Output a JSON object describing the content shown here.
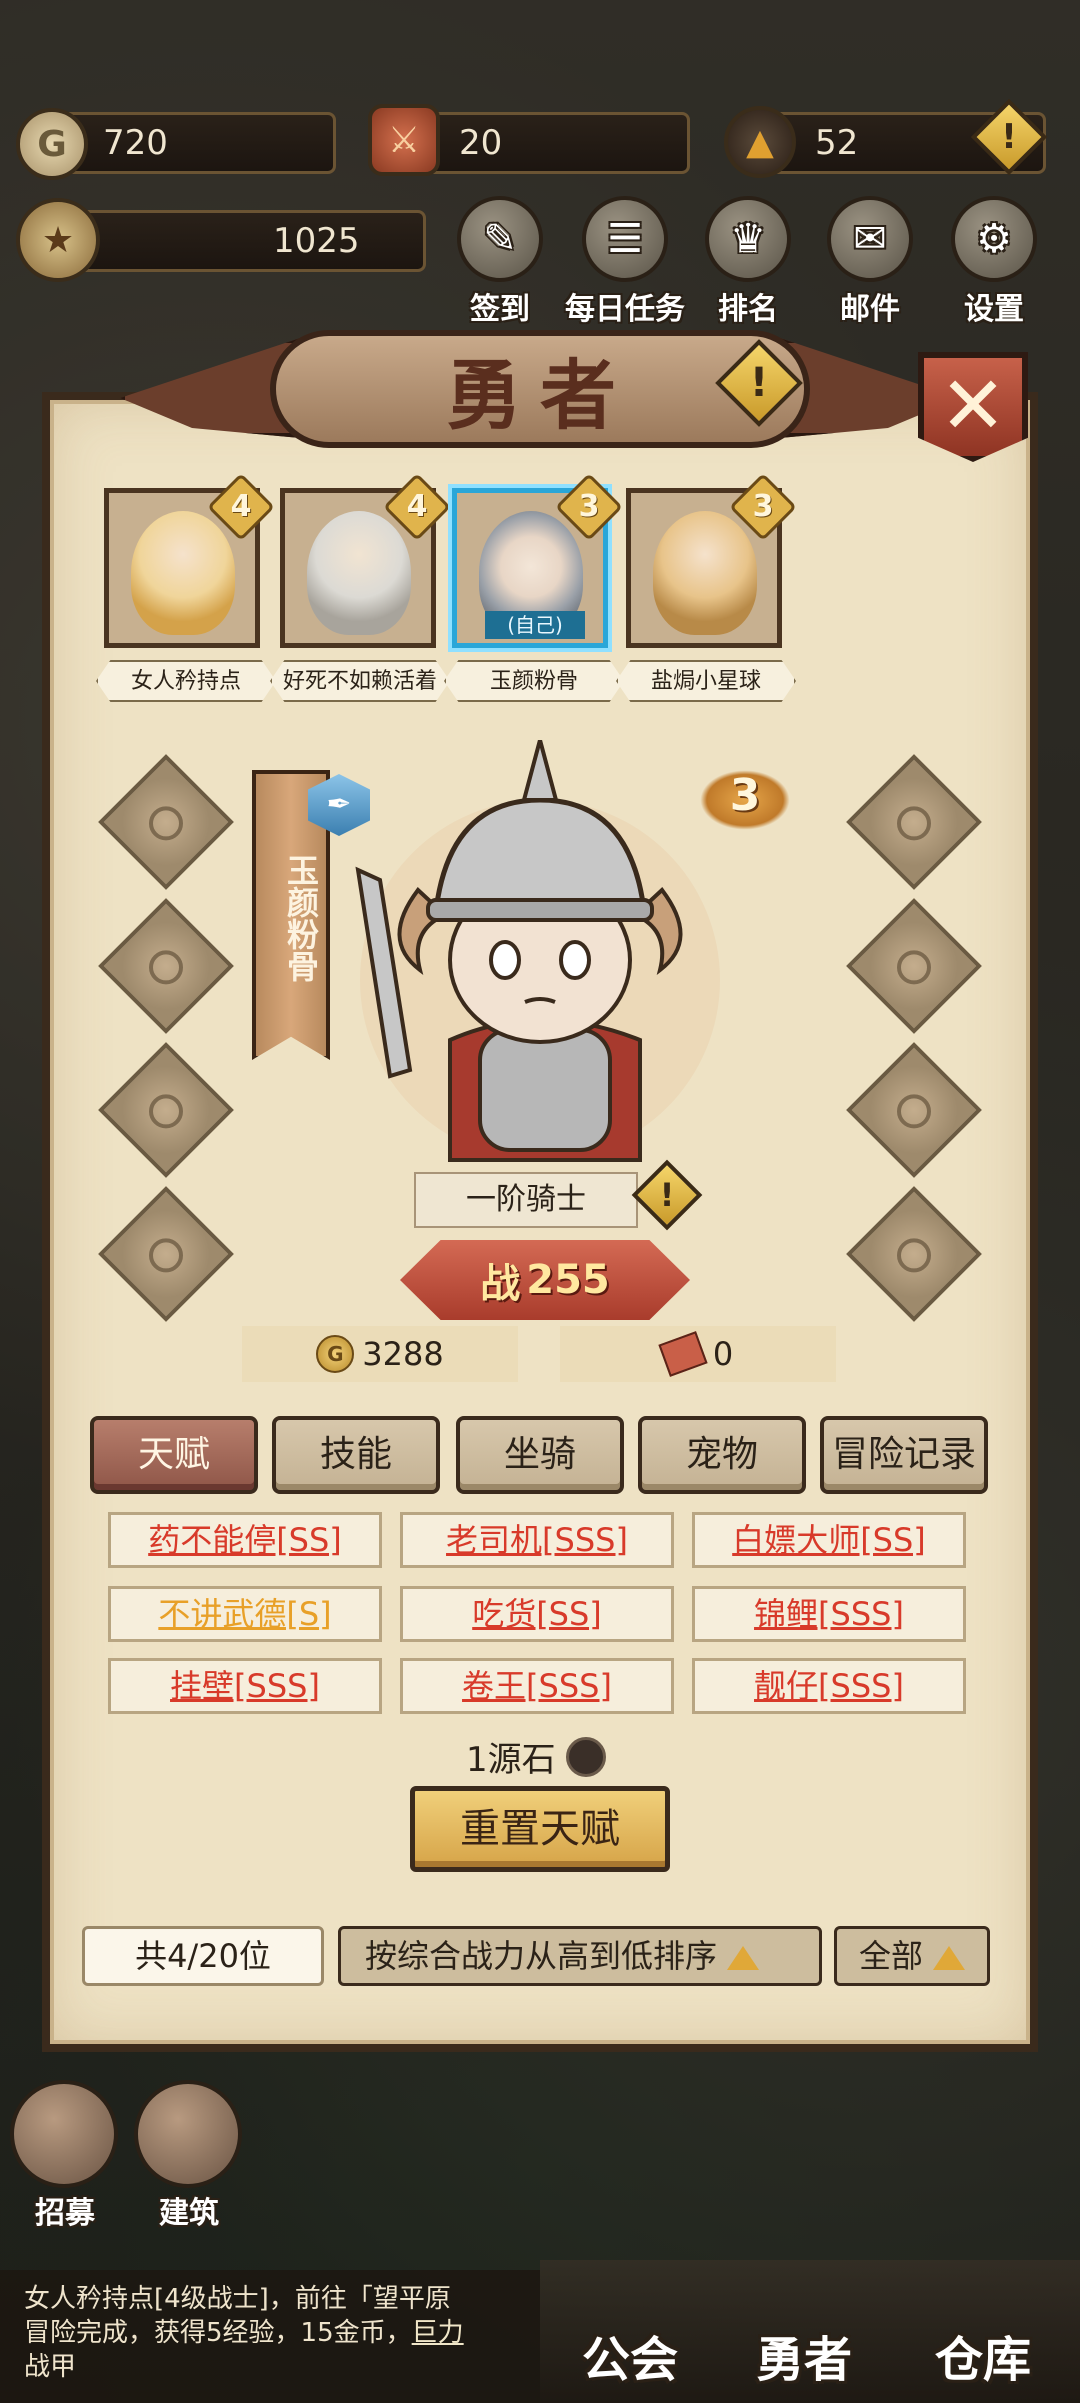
{
  "resources": {
    "gold": "720",
    "badge": "20",
    "stone": "52",
    "rank": "1025"
  },
  "top_menu": [
    {
      "label": "签到",
      "icon": "sign-in-icon"
    },
    {
      "label": "每日任务",
      "icon": "daily-quest-icon"
    },
    {
      "label": "排名",
      "icon": "ranking-icon"
    },
    {
      "label": "邮件",
      "icon": "mail-icon"
    },
    {
      "label": "设置",
      "icon": "settings-gear-icon"
    }
  ],
  "panel": {
    "title": "勇者",
    "heroes": [
      {
        "name": "女人矜持点",
        "level": "4"
      },
      {
        "name": "好死不如赖活着",
        "level": "4"
      },
      {
        "name": "玉颜粉骨",
        "level": "3",
        "tag": "(自己)"
      },
      {
        "name": "盐焗小星球",
        "level": "3"
      }
    ],
    "selected": {
      "name": "玉颜粉骨",
      "rank": "3",
      "class": "一阶骑士",
      "power_label": "战",
      "power": "255",
      "gold": "3288",
      "tickets": "0"
    },
    "tabs": [
      "天赋",
      "技能",
      "坐骑",
      "宠物",
      "冒险记录"
    ],
    "talents": [
      {
        "label": "药不能停[SS]",
        "color": "red"
      },
      {
        "label": "老司机[SSS]",
        "color": "red"
      },
      {
        "label": "白嫖大师[SS]",
        "color": "red"
      },
      {
        "label": "不讲武德[S]",
        "color": "orange"
      },
      {
        "label": "吃货[SS]",
        "color": "red"
      },
      {
        "label": "锦鲤[SSS]",
        "color": "red"
      },
      {
        "label": "挂壁[SSS]",
        "color": "red"
      },
      {
        "label": "卷王[SSS]",
        "color": "red"
      },
      {
        "label": "靓仔[SSS]",
        "color": "red"
      }
    ],
    "reset_cost": "1源石",
    "reset_label": "重置天赋",
    "count": "共4/20位",
    "sort_label": "按综合战力从高到低排序",
    "filter_label": "全部"
  },
  "bottom": {
    "left_buttons": [
      "招募",
      "建筑"
    ],
    "log_line1": "女人矜持点[4级战士]，前往「望平原",
    "log_line2": "冒险完成，获得5经验，15金币，",
    "log_link": "巨力",
    "log_line3": "战甲",
    "nav": [
      "公会",
      "勇者",
      "仓库"
    ]
  },
  "colors": {
    "talent_red": "#d83a2a",
    "talent_orange": "#e8a028",
    "panel_bg": "#eee2c4",
    "accent_gold": "#e0b44c"
  }
}
